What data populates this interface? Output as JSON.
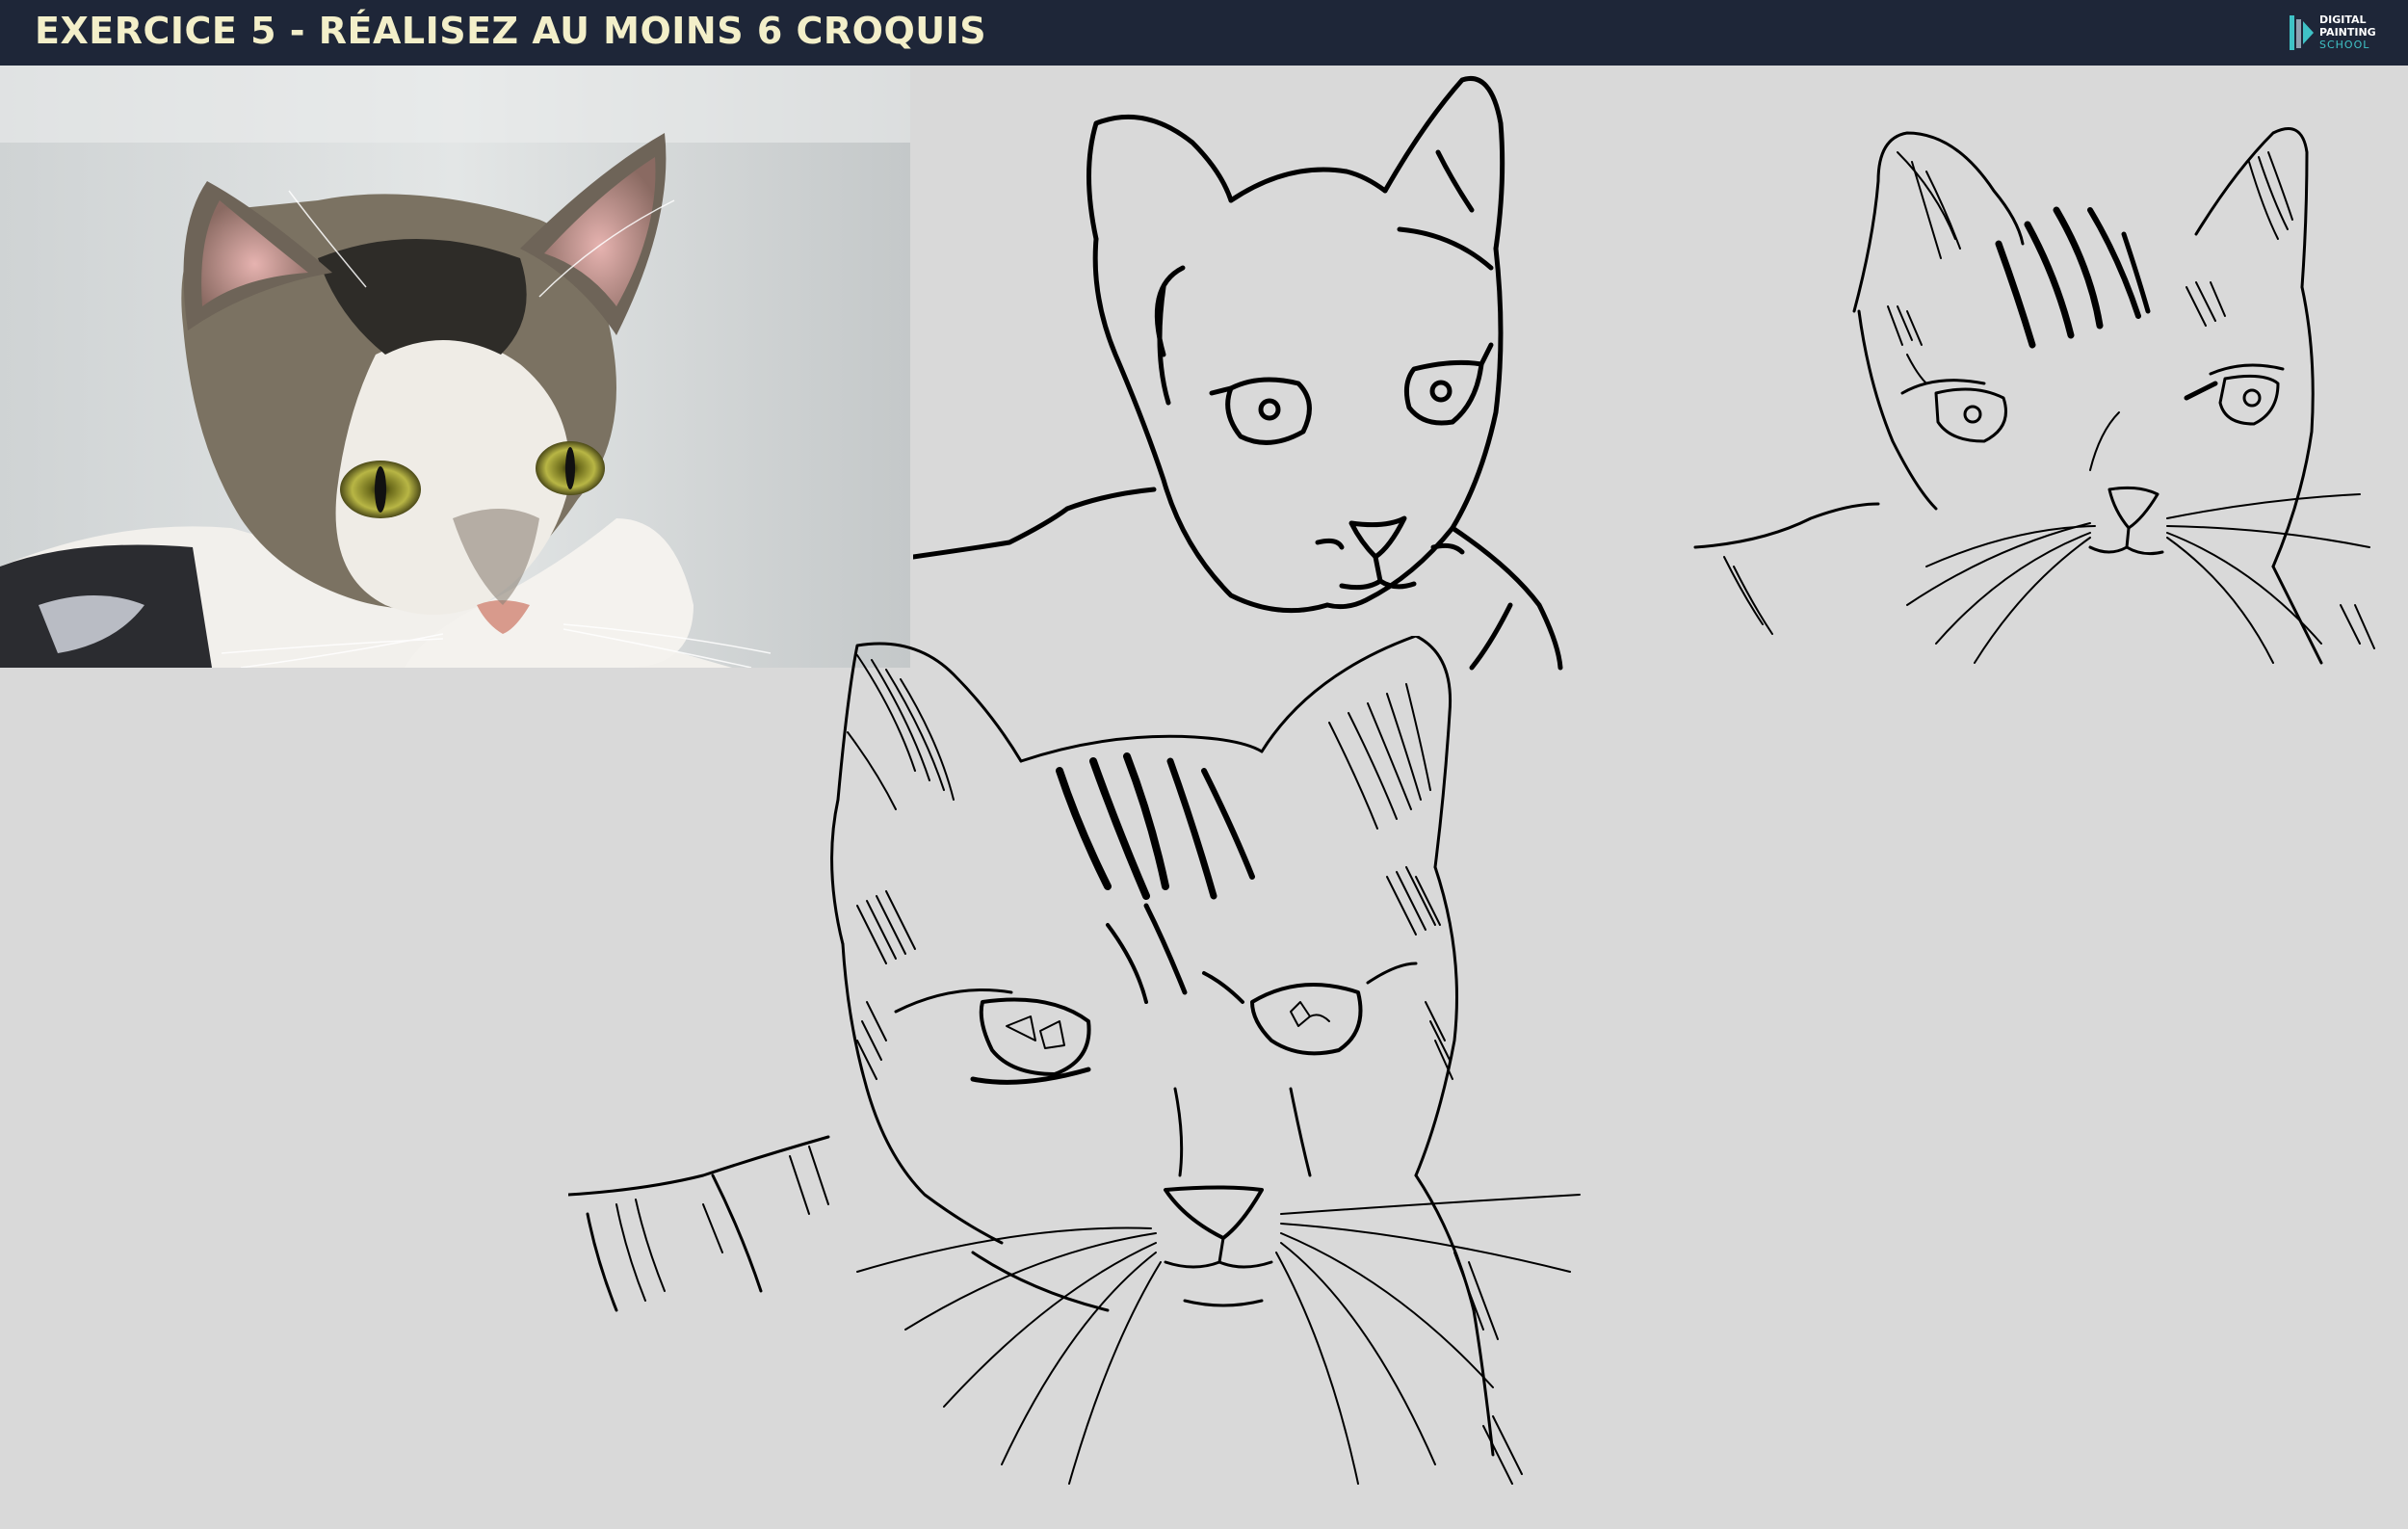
{
  "header": {
    "title": "EXERCICE 5 - RÉALISEZ AU MOINS 6 CROQUIS",
    "background": "#1e2638",
    "title_color": "#f3efc9"
  },
  "logo": {
    "line1": "DIGITAL",
    "line2": "PAINTING",
    "line3": "SCHOOL",
    "accent": "#3fc2c6"
  },
  "canvas": {
    "background": "#d9d9d9"
  },
  "reference_photo": {
    "subject": "cat-photo"
  },
  "sketches": [
    {
      "name": "sketch-simple-outline"
    },
    {
      "name": "sketch-with-stripes"
    },
    {
      "name": "sketch-detailed"
    }
  ]
}
